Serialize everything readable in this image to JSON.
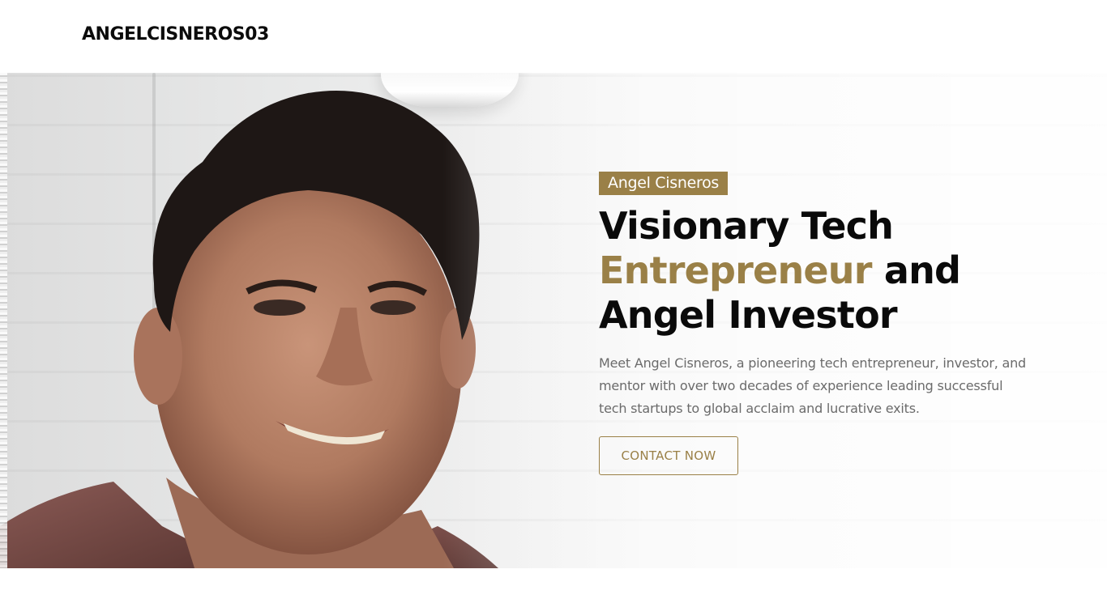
{
  "header": {
    "brand": "ANGELCISNEROS03"
  },
  "hero": {
    "name_tag": "Angel Cisneros",
    "headline": {
      "line1": "Visionary Tech",
      "accent": "Entrepreneur",
      "line2_rest": " and",
      "line3": "Angel Investor"
    },
    "intro": "Meet Angel Cisneros, a pioneering tech entrepreneur, investor, and mentor with over two decades of experience leading successful tech startups to global acclaim and lucrative exits.",
    "cta_label": "CONTACT NOW",
    "portrait_icon": "portrait-photo"
  },
  "colors": {
    "accent": "#9a8047",
    "heading": "#0a0a0a",
    "body_text": "#6b6b6b",
    "background": "#ffffff"
  }
}
